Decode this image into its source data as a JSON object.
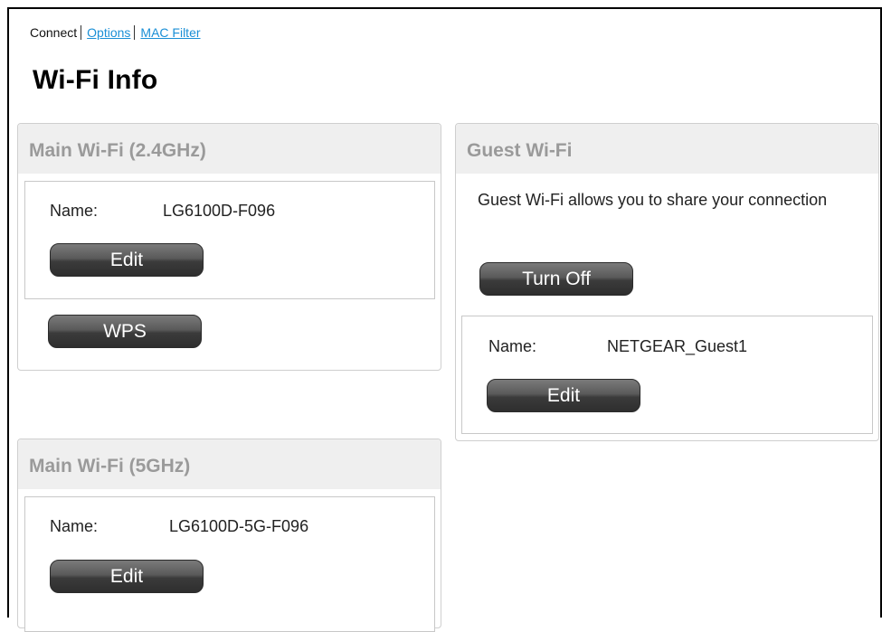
{
  "subnav": {
    "connect": "Connect",
    "options": "Options",
    "mac_filter": "MAC Filter"
  },
  "page_title": "Wi-Fi Info",
  "main24": {
    "title": "Main Wi-Fi (2.4GHz)",
    "name_label": "Name:",
    "name_value": "LG6100D-F096",
    "edit_label": "Edit",
    "wps_label": "WPS"
  },
  "main5": {
    "title": "Main Wi-Fi (5GHz)",
    "name_label": "Name:",
    "name_value": "LG6100D-5G-F096",
    "edit_label": "Edit"
  },
  "guest": {
    "title": "Guest Wi-Fi",
    "description": "Guest Wi-Fi allows you to share your connection",
    "turn_off_label": "Turn Off",
    "name_label": "Name:",
    "name_value": "NETGEAR_Guest1",
    "edit_label": "Edit"
  },
  "colors": {
    "link": "#1a8fd6",
    "panel_header_bg": "#efefef",
    "panel_header_text": "#9a9a9a",
    "button_dark": "#3b3b3b"
  }
}
